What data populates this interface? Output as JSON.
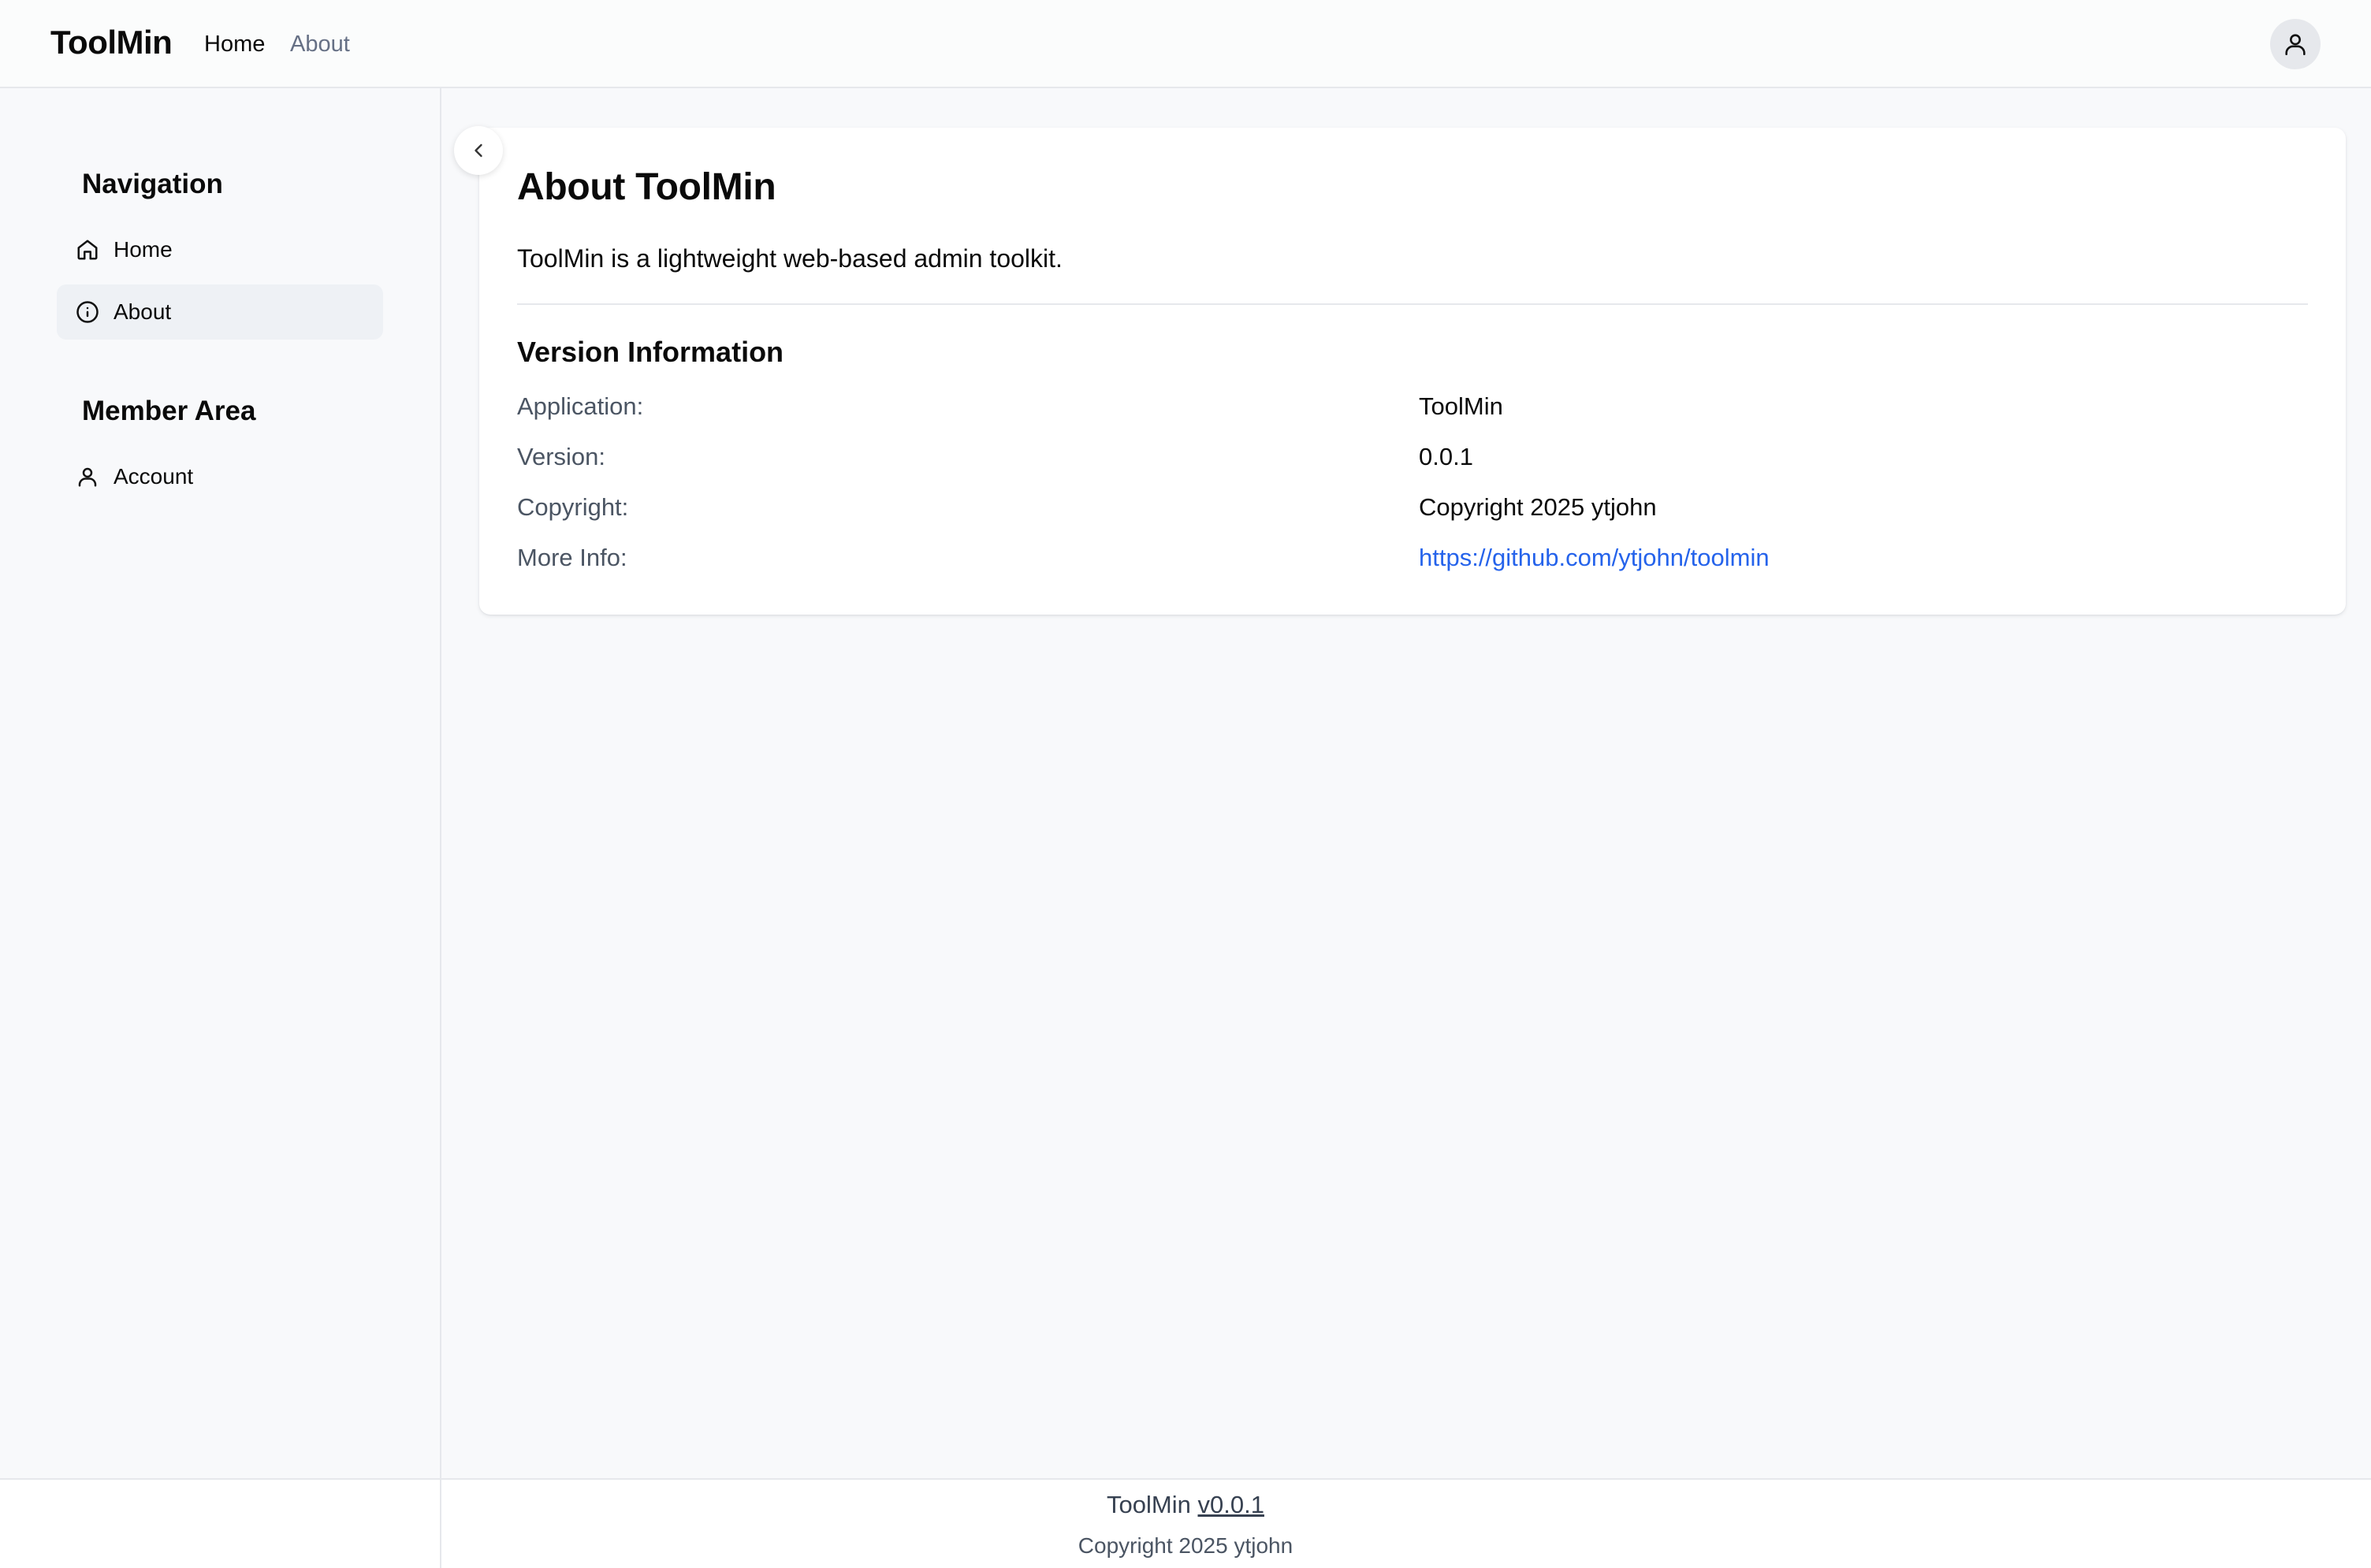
{
  "app": {
    "brand": "ToolMin"
  },
  "topnav": {
    "home": "Home",
    "about": "About"
  },
  "user_menu": {
    "icon": "user-icon"
  },
  "sidebar": {
    "sections": [
      {
        "heading": "Navigation",
        "items": [
          {
            "label": "Home",
            "icon": "home-icon",
            "active": false
          },
          {
            "label": "About",
            "icon": "info-icon",
            "active": true
          }
        ]
      },
      {
        "heading": "Member Area",
        "items": [
          {
            "label": "Account",
            "icon": "user-icon",
            "active": false
          }
        ]
      }
    ]
  },
  "collapse_toggle": {
    "icon": "chevron-left-icon"
  },
  "about": {
    "title": "About ToolMin",
    "description": "ToolMin is a lightweight web-based admin toolkit.",
    "version_section": {
      "title": "Version Information",
      "rows": [
        {
          "label": "Application:",
          "value": "ToolMin"
        },
        {
          "label": "Version:",
          "value": "0.0.1"
        },
        {
          "label": "Copyright:",
          "value": "Copyright 2025 ytjohn"
        },
        {
          "label": "More Info:",
          "value": "https://github.com/ytjohn/toolmin"
        }
      ]
    }
  },
  "footer": {
    "app_name": "ToolMin",
    "version_link": "v0.0.1",
    "copyright": "Copyright 2025 ytjohn"
  },
  "colors": {
    "link": "#2563eb",
    "active_bg": "#eef1f5",
    "page_bg": "#f8f9fb"
  }
}
